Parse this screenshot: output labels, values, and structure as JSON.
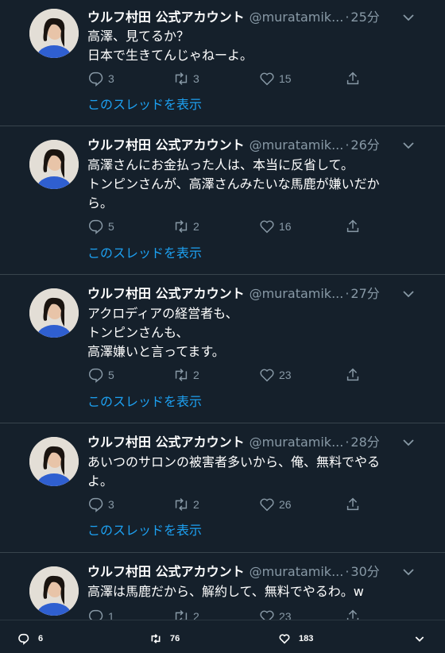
{
  "tweets": [
    {
      "name": "ウルフ村田 公式アカウント",
      "handle": "@muratamik...",
      "time": "25分",
      "text": "高澤、見てるか？\n日本で生きてんじゃねーよ。",
      "replies": "3",
      "retweets": "3",
      "likes": "15",
      "thread_link": "このスレッドを表示"
    },
    {
      "name": "ウルフ村田 公式アカウント",
      "handle": "@muratamik...",
      "time": "26分",
      "text": "高澤さんにお金払った人は、本当に反省して。\nトンピンさんが、高澤さんみたいな馬鹿が嫌いだか\nら。",
      "replies": "5",
      "retweets": "2",
      "likes": "16",
      "thread_link": "このスレッドを表示"
    },
    {
      "name": "ウルフ村田 公式アカウント",
      "handle": "@muratamik...",
      "time": "27分",
      "text": "アクロディアの経営者も、\nトンピンさんも、\n高澤嫌いと言ってます。",
      "replies": "5",
      "retweets": "2",
      "likes": "23",
      "thread_link": "このスレッドを表示"
    },
    {
      "name": "ウルフ村田 公式アカウント",
      "handle": "@muratamik...",
      "time": "28分",
      "text": "あいつのサロンの被害者多いから、俺、無料でやる\nよ。",
      "replies": "3",
      "retweets": "2",
      "likes": "26",
      "thread_link": "このスレッドを表示"
    },
    {
      "name": "ウルフ村田 公式アカウント",
      "handle": "@muratamik...",
      "time": "30分",
      "text": "高澤は馬鹿だから、解約して、無料でやるわ。w",
      "replies": "1",
      "retweets": "2",
      "likes": "23",
      "thread_link": ""
    }
  ],
  "bottom_bar": {
    "replies": "6",
    "retweets": "76",
    "likes": "183"
  },
  "colors": {
    "background": "#15202b",
    "muted": "#8899a6",
    "accent": "#1da1f2",
    "divider": "#38444d"
  },
  "icons": {
    "reply": "reply-icon",
    "retweet": "retweet-icon",
    "like": "heart-icon",
    "share": "share-icon",
    "caret": "chevron-down-icon"
  }
}
